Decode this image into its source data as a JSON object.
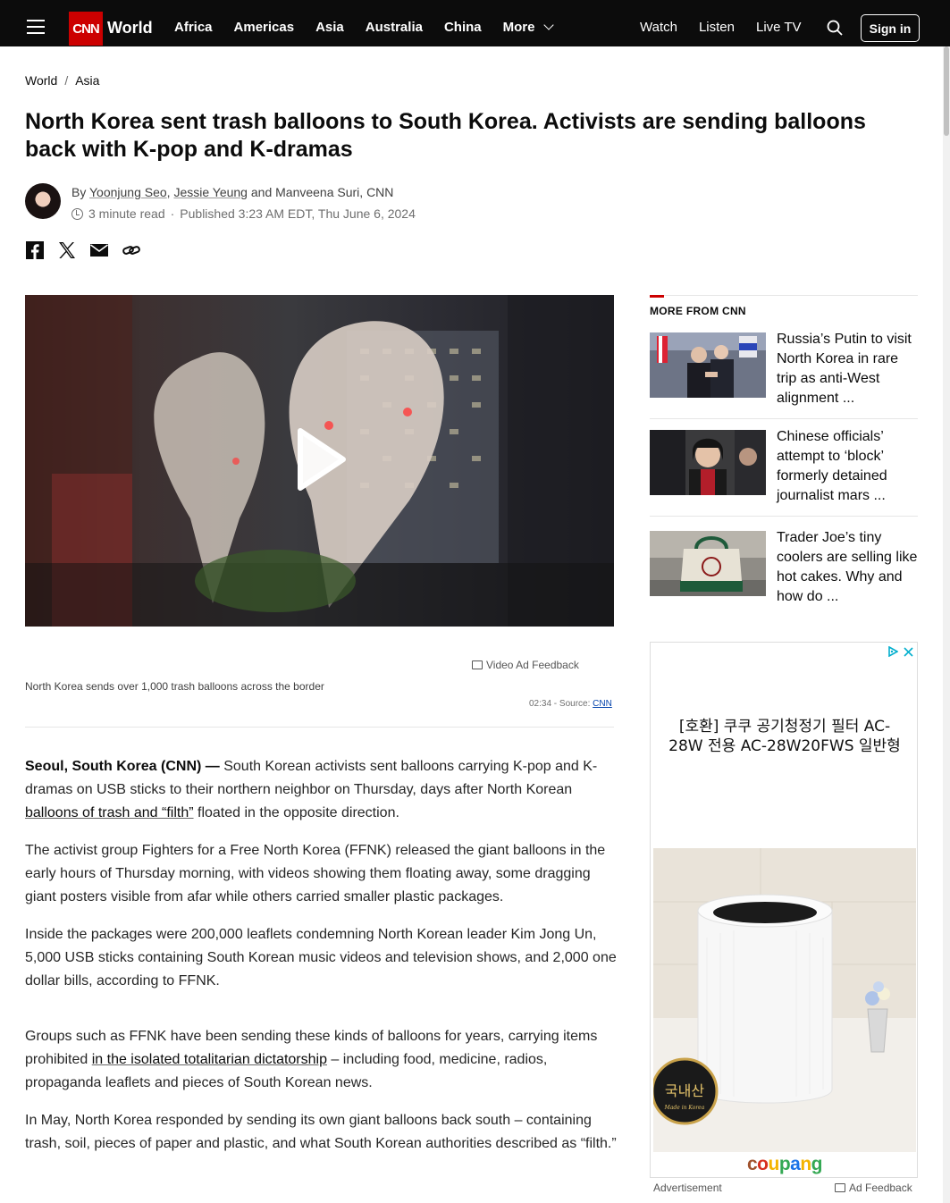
{
  "header": {
    "logo_text": "CNN",
    "section": "World",
    "nav": [
      "Africa",
      "Americas",
      "Asia",
      "Australia",
      "China"
    ],
    "more_label": "More",
    "right_nav": [
      "Watch",
      "Listen",
      "Live TV"
    ],
    "sign_in": "Sign in"
  },
  "breadcrumb": {
    "first": "World",
    "second": "Asia"
  },
  "article": {
    "headline": "North Korea sent trash balloons to South Korea. Activists are sending balloons back with K-pop and K-dramas",
    "byline_prefix": "By",
    "author1": "Yoonjung Seo",
    "author2": "Jessie Yeung",
    "byline_rest": "and Manveena Suri, CNN",
    "read_time": "3 minute read",
    "published": "Published 3:23 AM EDT, Thu June 6, 2024",
    "video_ad_feedback": "Video Ad Feedback",
    "video_caption": "North Korea sends over 1,000 trash balloons across the border",
    "video_duration": "02:34 - Source:",
    "video_source": "CNN",
    "p1_lead": "Seoul, South Korea (CNN) —",
    "p1_a": " South Korean activists sent balloons carrying K-pop and K-dramas on USB sticks to their northern neighbor on Thursday, days after North Korean ",
    "p1_link": "balloons of trash and “filth”",
    "p1_b": " floated in the opposite direction.",
    "p2": "The activist group Fighters for a Free North Korea (FFNK) released the giant balloons in the early hours of Thursday morning, with videos showing them floating away, some dragging giant posters visible from afar while others carried smaller plastic packages.",
    "p3": "Inside the packages were 200,000 leaflets condemning North Korean leader Kim Jong Un, 5,000 USB sticks containing South Korean music videos and television shows, and 2,000 one dollar bills, according to FFNK.",
    "p4_a": "Groups such as FFNK have been sending these kinds of balloons for years, carrying items prohibited ",
    "p4_link": "in the isolated totalitarian dictatorship",
    "p4_b": " – including food, medicine, radios, propaganda leaflets and pieces of South Korean news.",
    "p5": "In May, North Korea responded by sending its own giant balloons back south – containing trash, soil, pieces of paper and plastic, and what South Korean authorities described as “filth.”"
  },
  "sidebar": {
    "title": "MORE FROM CNN",
    "items": [
      {
        "text": "Russia’s Putin to visit North Korea in rare trip as anti-West alignment ..."
      },
      {
        "text": "Chinese officials’ attempt to ‘block’ formerly detained journalist mars ..."
      },
      {
        "text": "Trader Joe’s tiny coolers are selling like hot cakes. Why and how do ..."
      }
    ]
  },
  "ad": {
    "text": "[호환] 쿠쿠 공기청정기 필터 AC-28W 전용 AC-28W20FWS 일반형",
    "badge": "국내산",
    "badge_sub": "Made in Korea",
    "brand": [
      "c",
      "o",
      "u",
      "p",
      "a",
      "n",
      "g"
    ],
    "label": "Advertisement",
    "feedback": "Ad Feedback"
  }
}
